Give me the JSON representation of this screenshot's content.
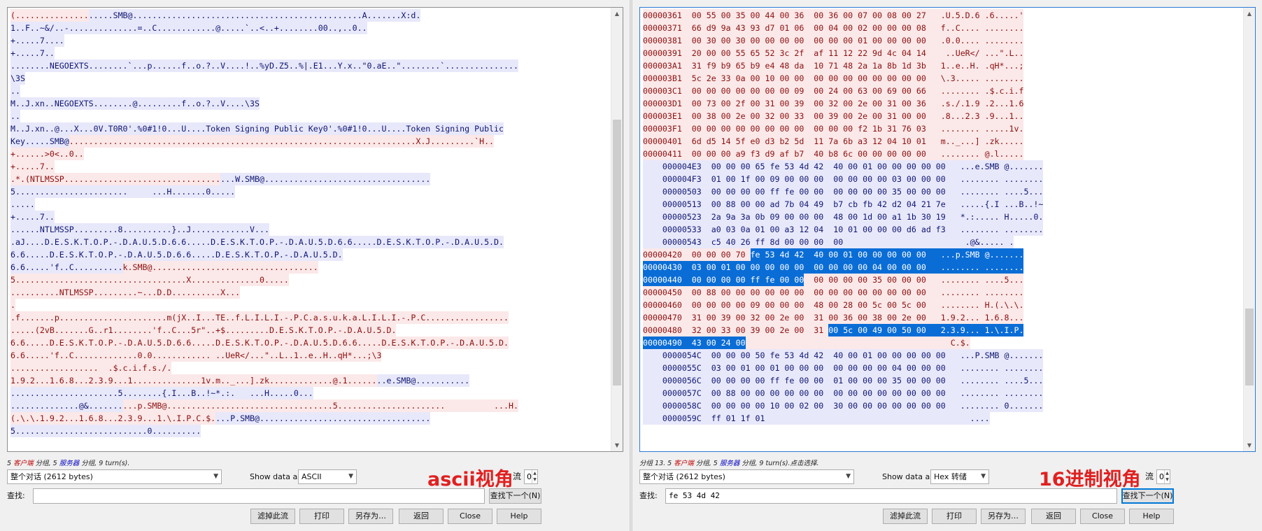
{
  "common": {
    "conversation_select": "整个对话 (2612 bytes)",
    "show_data_label": "Show data as",
    "stream_label": "流",
    "stream_value": "0",
    "find_label": "查找:",
    "find_next": "查找下一个(N)",
    "buttons": {
      "filter": "滤掉此流",
      "print": "打印",
      "save_as": "另存为…",
      "back": "返回",
      "close": "Close",
      "help": "Help"
    },
    "client_color": "#8b0f0f",
    "server_color": "#0e1670",
    "selection_color": "#0a6dd6"
  },
  "left": {
    "status_pre": "5 ",
    "status_client": "客户端",
    "status_mid": " 分组, 5 ",
    "status_server": "服务器",
    "status_post": " 分组, 9 turn(s).",
    "show_as": "ASCII",
    "annotation": "ascii视角",
    "find_value": "",
    "lines": [
      [
        [
          "c",
          "(..............."
        ],
        [
          "s",
          ".....SMB@...............................................A.......X:d."
        ]
      ],
      [
        [
          "s",
          "1..F..~&/..-..............=..C............@.....`..<..+........00..,..0.."
        ]
      ],
      [
        [
          "s",
          "+.....7...."
        ]
      ],
      [
        [
          "s",
          "+.....7.."
        ]
      ],
      [
        [
          "s",
          "........NEGOEXTS........`...p......f..o.?..V....!..%yD.Z5..%|.E1...Y.x..\"0.aE..\"........`..............."
        ]
      ],
      [
        [
          "s",
          "\\3S"
        ]
      ],
      [
        [
          "s",
          ".."
        ]
      ],
      [
        [
          "s",
          "M..J.xn..NEGOEXTS........@.........f..o.?..V....\\3S"
        ]
      ],
      [
        [
          "s",
          ".."
        ]
      ],
      [
        [
          "s",
          "M..J.xn..@...X...0V.T0R0'.%0#1!0...U....Token Signing Public Key0'.%0#1!0...U....Token Signing Public"
        ]
      ],
      [
        [
          "s",
          "Key.....SMB@"
        ],
        [
          "c",
          ".......................................................................X.J.........`H.."
        ]
      ],
      [
        [
          "c",
          "+......>0<..0.."
        ]
      ],
      [
        [
          "c",
          "+.....7.."
        ]
      ],
      [
        [
          "c",
          ".*.(NTLMSSP................................"
        ],
        [
          "s",
          "...W.SMB@.................................."
        ]
      ],
      [
        [
          "s",
          "5.......................     ...H.......0....."
        ]
      ],
      [
        [
          "s",
          "....."
        ]
      ],
      [
        [
          "s",
          "+.....7.."
        ]
      ],
      [
        [
          "s",
          "......NTLMSSP.........8..........}..J............V..."
        ]
      ],
      [
        [
          "s",
          ".aJ....D.E.S.K.T.O.P.-.D.A.U.5.D.6.6.....D.E.S.K.T.O.P.-.D.A.U.5.D.6.6.....D.E.S.K.T.O.P.-.D.A.U.5.D."
        ]
      ],
      [
        [
          "s",
          "6.6.....D.E.S.K.T.O.P.-.D.A.U.5.D.6.6.....D.E.S.K.T.O.P.-.D.A.U.5.D."
        ]
      ],
      [
        [
          "s",
          "6.6.....'f..C.........."
        ],
        [
          "c",
          "k.SMB@.................................."
        ]
      ],
      [
        [
          "c",
          "5...................................X..............0....."
        ]
      ],
      [
        [
          "c",
          "..........NTLMSSP.........~...D.D..........X..."
        ]
      ],
      [
        [
          "c",
          "."
        ]
      ],
      [
        [
          "c",
          ".f.......p......................m(jX..I...TE..f.L.I.L.I.-.P.C.a.s.u.k.a.L.I.L.I.-.P.C................."
        ]
      ],
      [
        [
          "c",
          ".....(2vB.......G..r1........'f..C...5r\"..+$.........D.E.S.K.T.O.P.-.D.A.U.5.D."
        ]
      ],
      [
        [
          "c",
          "6.6.....D.E.S.K.T.O.P.-.D.A.U.5.D.6.6.....D.E.S.K.T.O.P.-.D.A.U.5.D.6.6.....D.E.S.K.T.O.P.-.D.A.U.5.D."
        ]
      ],
      [
        [
          "c",
          "6.6.....'f..C.............0.0............ ..UeR</...\"..L..1..e..H..qH*...;\\3"
        ]
      ],
      [
        [
          "c",
          "..................  .$.c.i.f.s./."
        ]
      ],
      [
        [
          "c",
          "1.9.2...1.6.8...2.3.9...1..............1v.m.._...].zk.............@.1......"
        ],
        [
          "s",
          "..e.SMB@..........."
        ]
      ],
      [
        [
          "s",
          "......................5........{.I...B..!~*.:.   ...H.....0..."
        ]
      ],
      [
        [
          "s",
          "..............@&......."
        ],
        [
          "c",
          "...p.SMB@..................................5......................          ...H."
        ]
      ],
      [
        [
          "c",
          "(.\\.\\.1.9.2...1.6.8...2.3.9...1.\\.I.P.C.$."
        ],
        [
          "s",
          "...P.SMB@..................................."
        ]
      ],
      [
        [
          "s",
          "5...........................0.........."
        ]
      ]
    ]
  },
  "right": {
    "status_pre": "分组 13. 5 ",
    "status_client": "客户端",
    "status_mid": " 分组, 5 ",
    "status_server": "服务器",
    "status_post": " 分组, 9 turn(s).点击选择.",
    "show_as": "Hex 转储",
    "annotation": "16进制视角",
    "find_value": "fe 53 4d 42",
    "lines": [
      [
        [
          "c",
          "00000361  00 55 00 35 00 44 00 36  00 36 00 07 00 08 00 27   .U.5.D.6 .6.....'"
        ]
      ],
      [
        [
          "c",
          "00000371  66 d9 9a 43 93 d7 01 06  00 04 00 02 00 00 00 08   f..C.... ........"
        ]
      ],
      [
        [
          "c",
          "00000381  00 30 00 30 00 00 00 00  00 00 00 01 00 00 00 00   .0.0.... ........"
        ]
      ],
      [
        [
          "c",
          "00000391  20 00 00 55 65 52 3c 2f  af 11 12 22 9d 4c 04 14    ..UeR</ ...\".L.."
        ]
      ],
      [
        [
          "c",
          "000003A1  31 f9 b9 65 b9 e4 48 da  10 71 48 2a 1a 8b 1d 3b   1..e..H. .qH*...;"
        ]
      ],
      [
        [
          "c",
          "000003B1  5c 2e 33 0a 00 10 00 00  00 00 00 00 00 00 00 00   \\.3..... ........"
        ]
      ],
      [
        [
          "c",
          "000003C1  00 00 00 00 00 00 00 09  00 24 00 63 00 69 00 66   ........ .$.c.i.f"
        ]
      ],
      [
        [
          "c",
          "000003D1  00 73 00 2f 00 31 00 39  00 32 00 2e 00 31 00 36   .s./.1.9 .2...1.6"
        ]
      ],
      [
        [
          "c",
          "000003E1  00 38 00 2e 00 32 00 33  00 39 00 2e 00 31 00 00   .8...2.3 .9...1.."
        ]
      ],
      [
        [
          "c",
          "000003F1  00 00 00 00 00 00 00 00  00 00 00 f2 1b 31 76 03   ........ .....1v."
        ]
      ],
      [
        [
          "c",
          "00000401  6d d5 14 5f e0 d3 b2 5d  11 7a 6b a3 12 04 10 01   m.._...] .zk....."
        ]
      ],
      [
        [
          "c",
          "00000411  00 00 00 a9 f3 d9 af b7  40 b8 6c 00 00 00 00 00   ........ @.l....."
        ]
      ],
      [
        [
          "s",
          "    000004E3  00 00 00 65 fe 53 4d 42  40 00 01 00 00 00 00 00   ...e.SMB @......."
        ]
      ],
      [
        [
          "s",
          "    000004F3  01 00 1f 00 09 00 00 00  00 00 00 00 03 00 00 00   ........ ........"
        ]
      ],
      [
        [
          "s",
          "    00000503  00 00 00 00 ff fe 00 00  00 00 00 00 35 00 00 00   ........ ....5..."
        ]
      ],
      [
        [
          "s",
          "    00000513  00 88 00 00 ad 7b 04 49  b7 cb fb 42 d2 04 21 7e   .....{.I ...B..!~"
        ]
      ],
      [
        [
          "s",
          "    00000523  2a 9a 3a 0b 09 00 00 00  48 00 1d 00 a1 1b 30 19   *.:..... H.....0."
        ]
      ],
      [
        [
          "s",
          "    00000533  a0 03 0a 01 00 a3 12 04  10 01 00 00 00 d6 ad f3   ........ ........"
        ]
      ],
      [
        [
          "s",
          "    00000543  c5 40 26 ff 8d 00 00 00  00                         .@&..... ."
        ]
      ],
      [
        [
          "c",
          "00000420  00 00 00 70 "
        ],
        [
          "selx",
          "fe 53 4d 42  40 00 01 00 00 00 00 00   ...p.SMB @......."
        ]
      ],
      [
        [
          "selx",
          "00000430  03 00 01 00 00 00 00 00  00 00 00 00 04 00 00 00   ........ ........"
        ]
      ],
      [
        [
          "selx",
          "00000440  00 00 00 00 ff fe 00 00"
        ],
        [
          "c",
          "  00 00 00 00 35 00 00 00   ........ ....5..."
        ]
      ],
      [
        [
          "c",
          "00000450  00 88 00 00 00 00 00 00  00 00 00 00 00 00 00 00   ........ ........"
        ]
      ],
      [
        [
          "c",
          "00000460  00 00 00 00 09 00 00 00  48 00 28 00 5c 00 5c 00   ........ H.(.\\.\\."
        ]
      ],
      [
        [
          "c",
          "00000470  31 00 39 00 32 00 2e 00  31 00 36 00 38 00 2e 00   1.9.2... 1.6.8..."
        ]
      ],
      [
        [
          "c",
          "00000480  32 00 33 00 39 00 2e 00  31 "
        ],
        [
          "selx",
          "00 5c 00 49 00 50 00   2.3.9... 1.\\.I.P."
        ]
      ],
      [
        [
          "selx",
          "00000490  43 00 24 00"
        ],
        [
          "c",
          "                                          C.$."
        ]
      ],
      [
        [
          "s",
          "    0000054C  00 00 00 50 fe 53 4d 42  40 00 01 00 00 00 00 00   ...P.SMB @......."
        ]
      ],
      [
        [
          "s",
          "    0000055C  03 00 01 00 01 00 00 00  00 00 00 00 04 00 00 00   ........ ........"
        ]
      ],
      [
        [
          "s",
          "    0000056C  00 00 00 00 ff fe 00 00  01 00 00 00 35 00 00 00   ........ ....5..."
        ]
      ],
      [
        [
          "s",
          "    0000057C  00 88 00 00 00 00 00 00  00 00 00 00 00 00 00 00   ........ ........"
        ]
      ],
      [
        [
          "s",
          "    0000058C  00 00 00 00 10 00 02 00  30 00 00 00 00 00 00 00   ........ 0......."
        ]
      ],
      [
        [
          "s",
          "    0000059C  ff 01 1f 01                                          ...."
        ]
      ]
    ]
  }
}
